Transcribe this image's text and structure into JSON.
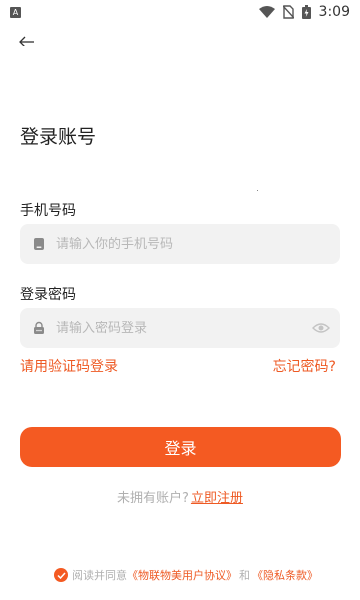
{
  "status_bar": {
    "notification_badge": "A",
    "time": "3:09"
  },
  "page": {
    "title": "登录账号"
  },
  "phone": {
    "label": "手机号码",
    "placeholder": "请输入你的手机号码",
    "value": ""
  },
  "password": {
    "label": "登录密码",
    "placeholder": "请输入密码登录",
    "value": ""
  },
  "links": {
    "sms_login": "请用验证码登录",
    "forgot_password": "忘记密码?"
  },
  "login_button": {
    "label": "登录"
  },
  "register": {
    "prompt": "未拥有账户?",
    "link": "立即注册"
  },
  "agreement": {
    "prefix": "阅读并同意",
    "user_agreement": "《物联物美用户协议》",
    "and": "和",
    "privacy": "《隐私条款》",
    "checked": true
  },
  "colors": {
    "accent": "#f45a22",
    "link": "#ee5a24",
    "input_bg": "#f2f2f2",
    "placeholder": "#b8b8b8"
  },
  "icons": {
    "back": "arrow-left-icon",
    "phone_field": "phone-icon",
    "password_field": "lock-icon",
    "show_password": "eye-icon",
    "agreement_check": "check-icon"
  }
}
